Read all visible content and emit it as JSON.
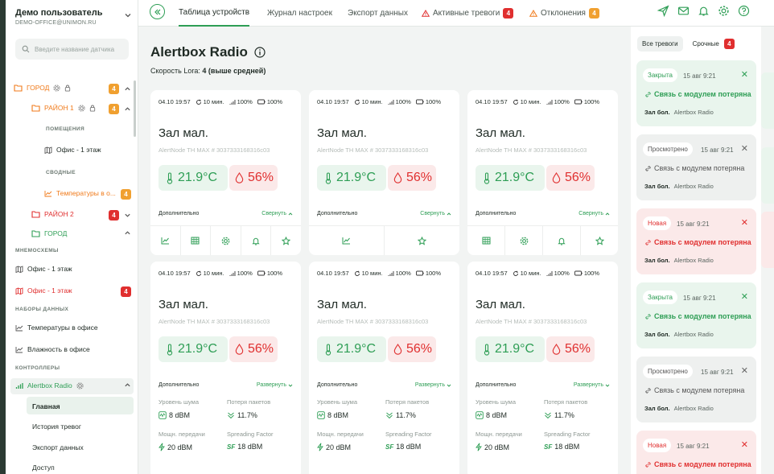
{
  "user": {
    "name": "Демо пользователь",
    "email": "DEMO-OFFICE@UNIMON.RU"
  },
  "search": {
    "placeholder": "Введите название датчика"
  },
  "tree": {
    "city": {
      "label": "ГОРОД",
      "badge": "4"
    },
    "district1": {
      "label": "РАЙОН 1",
      "badge": "4"
    },
    "rooms_title": "ПОМЕЩЕНИЯ",
    "office_floor": "Офис - 1 этаж",
    "summary_title": "СВОДНЫЕ",
    "temps_office": {
      "label": "Температуры в о...",
      "badge": "4"
    },
    "district2": {
      "label": "РАЙОН 2",
      "badge": "4"
    },
    "city2": {
      "label": "ГОРОД"
    }
  },
  "mnemo": {
    "title": "МНЕМОСХЕМЫ",
    "items": [
      {
        "label": "Офис - 1 этаж"
      },
      {
        "label": "Офис - 1 этаж",
        "badge": "4"
      }
    ]
  },
  "datasets": {
    "title": "НАБОРЫ ДАННЫХ",
    "items": [
      {
        "label": "Температуры в офисе"
      },
      {
        "label": "Влажность в офисе"
      }
    ]
  },
  "controllers": {
    "title": "КОНТРОЛЛЕРЫ",
    "active": "Alertbox Radio",
    "sub": [
      "Главная",
      "История тревог",
      "Экспорт данных",
      "Доступ"
    ]
  },
  "tabs": [
    {
      "label": "Таблица устройств"
    },
    {
      "label": "Журнал настроек"
    },
    {
      "label": "Экспорт данных"
    },
    {
      "label": "Активные тревоги",
      "badge": "4"
    },
    {
      "label": "Отклонения",
      "badge": "4"
    }
  ],
  "page": {
    "title": "Alertbox Radio",
    "lora_label": "Скорость Lora:",
    "lora_value": "4 (выше средней)"
  },
  "cards": [
    {
      "time": "04.10 19:57",
      "interval": "10 мин.",
      "signal": "100%",
      "battery": "100%",
      "name": "Зал мал.",
      "sub": "AlertNode TH MAX # 3037333168316c03",
      "temp": "21.9°C",
      "hum": "56%",
      "more": "Дополнительно",
      "toggle": "Свернуть"
    },
    {
      "time": "04.10 19:57",
      "interval": "10 мин.",
      "signal": "100%",
      "battery": "100%",
      "name": "Зал мал.",
      "sub": "AlertNode TH MAX # 3037333168316c03",
      "temp": "21.9°C",
      "hum": "56%",
      "more": "Дополнительно",
      "toggle": "Свернуть"
    },
    {
      "time": "04.10 19:57",
      "interval": "10 мин.",
      "signal": "100%",
      "battery": "100%",
      "name": "Зал мал.",
      "sub": "AlertNode TH MAX # 3037333168316c03",
      "temp": "21.9°C",
      "hum": "56%",
      "more": "Дополнительно",
      "toggle": "Свернуть"
    },
    {
      "time": "04.10 19:57",
      "interval": "10 мин.",
      "signal": "100%",
      "battery": "100%",
      "name": "Зал мал.",
      "sub": "AlertNode TH MAX # 3037333168316c03",
      "temp": "21.9°C",
      "hum": "56%",
      "more": "Дополнительно",
      "toggle": "Развернуть",
      "m": {
        "noise_l": "Уровень шума",
        "noise_v": "8 dBM",
        "loss_l": "Потеря пакетов",
        "loss_v": "11.7%",
        "power_l": "Мощн. передачи",
        "power_v": "20 dBM",
        "sf_l": "Spreading Factor",
        "sf_v": "18 dBM"
      }
    },
    {
      "time": "04.10 19:57",
      "interval": "10 мин.",
      "signal": "100%",
      "battery": "100%",
      "name": "Зал мал.",
      "sub": "AlertNode TH MAX # 3037333168316c03",
      "temp": "21.9°C",
      "hum": "56%",
      "more": "Дополнительно",
      "toggle": "Развернуть",
      "m": {
        "noise_l": "Уровень шума",
        "noise_v": "8 dBM",
        "loss_l": "Потеря пакетов",
        "loss_v": "11.7%",
        "power_l": "Мощн. передачи",
        "power_v": "20 dBM",
        "sf_l": "Spreading Factor",
        "sf_v": "18 dBM"
      }
    },
    {
      "time": "04.10 19:57",
      "interval": "10 мин.",
      "signal": "100%",
      "battery": "100%",
      "name": "Зал мал.",
      "sub": "AlertNode TH MAX # 3037333168316c03",
      "temp": "21.9°C",
      "hum": "56%",
      "more": "Дополнительно",
      "toggle": "Развернуть",
      "m": {
        "noise_l": "Уровень шума",
        "noise_v": "8 dBM",
        "loss_l": "Потеря пакетов",
        "loss_v": "11.7%",
        "power_l": "Мощн. передачи",
        "power_v": "20 dBM",
        "sf_l": "Spreading Factor",
        "sf_v": "18 dBM"
      }
    }
  ],
  "alerts": {
    "tab_all": "Все тревоги",
    "tab_urgent": "Срочные",
    "urgent_badge": "4",
    "items": [
      {
        "status": "Закрыта",
        "date": "15 авг 9:21",
        "msg": "Связь с модулем потеряна",
        "room": "Зал бол.",
        "device": "Alertbox Radio"
      },
      {
        "status": "Просмотрено",
        "date": "15 авг 9:21",
        "msg": "Связь с модулем потеряна",
        "room": "Зал бол.",
        "device": "Alertbox Radio"
      },
      {
        "status": "Новая",
        "date": "15 авг 9:21",
        "msg": "Связь с модулем потеряна",
        "room": "Зал бол.",
        "device": "Alertbox Radio"
      },
      {
        "status": "Закрыта",
        "date": "15 авг 9:21",
        "msg": "Связь с модулем потеряна",
        "room": "Зал бол.",
        "device": "Alertbox Radio"
      },
      {
        "status": "Просмотрено",
        "date": "15 авг 9:21",
        "msg": "Связь с модулем потеряна",
        "room": "Зал бол.",
        "device": "Alertbox Radio"
      },
      {
        "status": "Новая",
        "date": "15 авг 9:21",
        "msg": "Связь с модулем потеряна"
      }
    ]
  },
  "colors": {
    "accent": "#2e9e55",
    "warning": "#f07a1a",
    "danger": "#e02f2f"
  }
}
